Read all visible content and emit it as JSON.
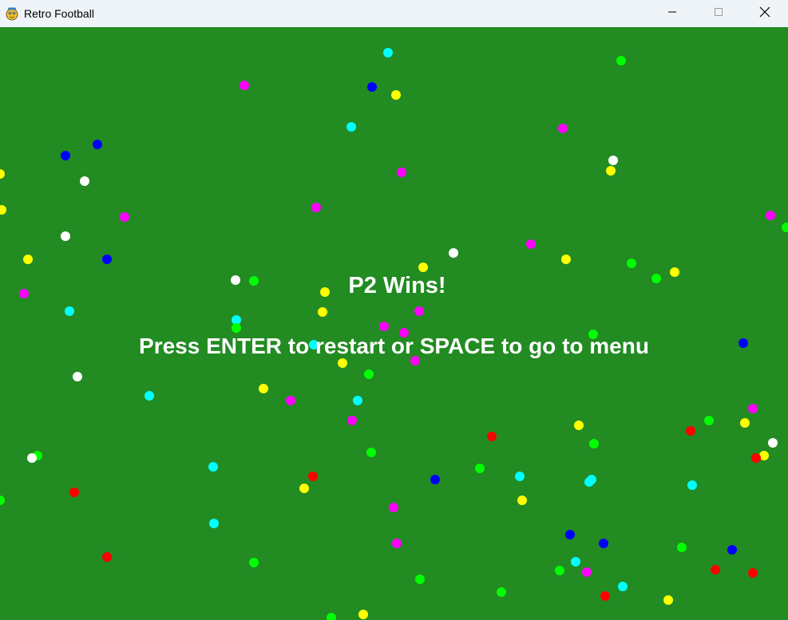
{
  "window": {
    "title": "Retro Football",
    "app_icon": "pygame-snake-icon",
    "controls": [
      "minimize-icon",
      "maximize-icon",
      "close-icon"
    ]
  },
  "game": {
    "background_color": "#228b22",
    "winner_text": "P2 Wins!",
    "instructions": "Press ENTER to restart or SPACE to go to menu",
    "text_color": "#ffffff"
  },
  "confetti": {
    "colors": {
      "yellow": "#ffff00",
      "cyan": "#00ffff",
      "magenta": "#ff00ff",
      "green": "#00ff00",
      "blue": "#0000ff",
      "white": "#ffffff",
      "red": "#ff0000"
    }
  }
}
